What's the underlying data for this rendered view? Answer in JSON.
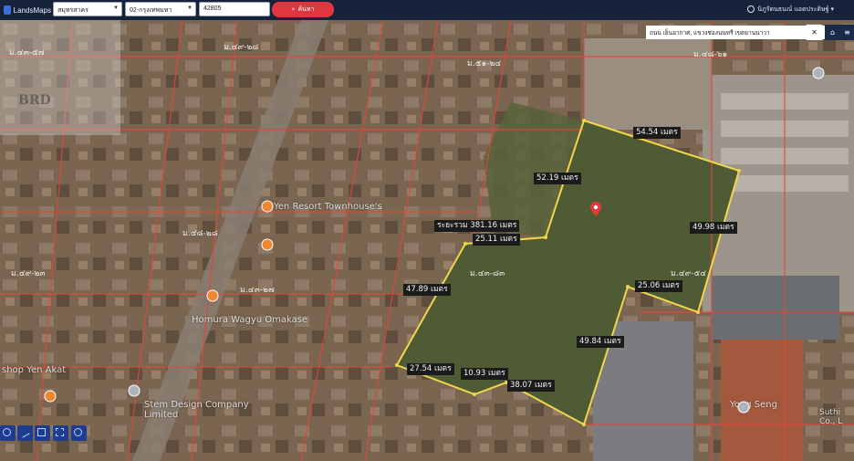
{
  "header": {
    "app_name": "LandsMaps",
    "province": "สมุทรสาคร",
    "district": "02-กรุงเทพมหา",
    "parcel_number": "42805",
    "search_label": "ค้นหา",
    "user_name": "นิภูรัตนธนณ์ แอดประดิษฐ์"
  },
  "search_panel": {
    "text": "ถนน เย็นอากาศ, แขวงช่องนนทรี เขตยานนาวา"
  },
  "watermark": {
    "text": "BRD"
  },
  "parcel_labels": [
    {
      "text": "ม.๔๓-๕๗"
    },
    {
      "text": "ม.๔๙-๒๘"
    },
    {
      "text": "ม.๕๑-๒๔"
    },
    {
      "text": "ม.๔๘-๖๑"
    },
    {
      "text": "ม.๔๘-๒๘"
    },
    {
      "text": "ม.๔๙-๒๓"
    },
    {
      "text": "ม.๔๓-๘๓"
    },
    {
      "text": "ม.๔๙-๕๔"
    },
    {
      "text": "ม.๔๓-๒๗"
    }
  ],
  "places": [
    {
      "name": "Yen Resort Townhouse's"
    },
    {
      "name": "Homura Wagyu Omakase"
    },
    {
      "name": "Stem Design Company Limited"
    },
    {
      "name": "Yong Seng"
    },
    {
      "name": "shop Yen Akat"
    },
    {
      "name": "Suthi Co., L"
    }
  ],
  "measurements": {
    "total_distance": "ระยะรวม  381.16  เมตร",
    "segments": [
      "54.54 เมตร",
      "52.19 เมตร",
      "25.11 เมตร",
      "49.98 เมตร",
      "47.89 เมตร",
      "25.06 เมตร",
      "49.84 เมตร",
      "27.54 เมตร",
      "10.93 เมตร",
      "38.07 เมตร"
    ]
  },
  "colors": {
    "topbar": "#16223a",
    "search_button": "#e0363f",
    "boundary_highlight": "#f2d64a",
    "parcel_lines": "#e0473a",
    "marker": "#e23a3a"
  },
  "icons": {
    "close": "close-icon",
    "home": "home-icon",
    "menu": "menu-icon",
    "search": "search-icon",
    "marker": "location-marker-icon"
  }
}
